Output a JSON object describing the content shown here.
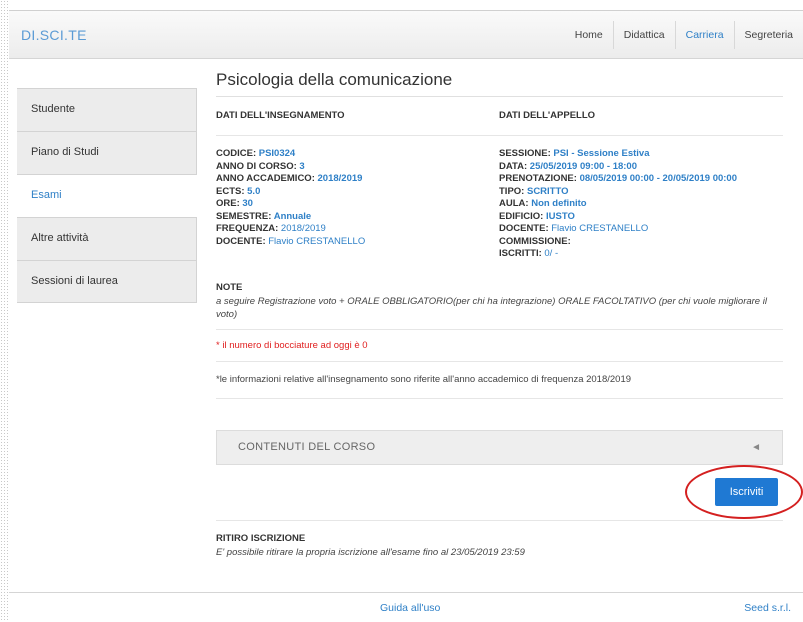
{
  "brand": "DI.SCI.TE",
  "nav": [
    "Home",
    "Didattica",
    "Carriera",
    "Segreteria"
  ],
  "nav_active": "Carriera",
  "sidebar": {
    "items": [
      {
        "label": "Studente"
      },
      {
        "label": "Piano di Studi"
      },
      {
        "label": "Esami"
      },
      {
        "label": "Altre attività"
      },
      {
        "label": "Sessioni di laurea"
      }
    ],
    "active": "Esami"
  },
  "page_title": "Psicologia della comunicazione",
  "teaching": {
    "heading": "DATI DELL'INSEGNAMENTO",
    "codice_label": "CODICE: ",
    "codice": "PSI0324",
    "anno_label": "ANNO DI CORSO: ",
    "anno": "3",
    "aa_label": "ANNO ACCADEMICO: ",
    "aa": "2018/2019",
    "ects_label": "ECTS: ",
    "ects": "5.0",
    "ore_label": "ORE: ",
    "ore": "30",
    "semestre_label": "SEMESTRE: ",
    "semestre": "Annuale",
    "frequenza_label": "FREQUENZA: ",
    "frequenza": "2018/2019",
    "docente_label": "DOCENTE: ",
    "docente": "Flavio CRESTANELLO"
  },
  "exam": {
    "heading": "DATI DELL'APPELLO",
    "sessione_label": "SESSIONE: ",
    "sessione": "PSI - Sessione Estiva",
    "data_label": "DATA: ",
    "data": "25/05/2019 09:00 - 18:00",
    "prenot_label": "PRENOTAZIONE: ",
    "prenot": "08/05/2019 00:00 - 20/05/2019 00:00",
    "tipo_label": "TIPO: ",
    "tipo": "SCRITTO",
    "aula_label": "AULA: ",
    "aula": "Non definito",
    "edificio_label": "EDIFICIO: ",
    "edificio": "IUSTO",
    "docente_label": "DOCENTE: ",
    "docente": "Flavio CRESTANELLO",
    "commissione_label": "COMMISSIONE:",
    "iscritti_label": "ISCRITTI: ",
    "iscritti": "0/ -"
  },
  "note": {
    "label": "NOTE",
    "text": "a seguire Registrazione voto + ORALE OBBLIGATORIO(per chi ha integrazione) ORALE FACOLTATIVO (per chi vuole migliorare il voto)"
  },
  "warning": "* il numero di bocciature ad oggi è 0",
  "info": "*le informazioni relative all'insegnamento sono riferite all'anno accademico di frequenza 2018/2019",
  "accordion": {
    "title": "CONTENUTI DEL CORSO",
    "arrow": "◄"
  },
  "enroll_button": "Iscriviti",
  "withdraw": {
    "label": "RITIRO ISCRIZIONE",
    "text": "E' possibile ritirare la propria iscrizione all'esame fino al 23/05/2019 23:59"
  },
  "footer": {
    "guide": "Guida all'uso",
    "company": "Seed s.r.l."
  },
  "colors": {
    "link": "#2f80c7",
    "button": "#1f79d3",
    "warning": "#e02020",
    "highlight_circle": "#d42020"
  }
}
